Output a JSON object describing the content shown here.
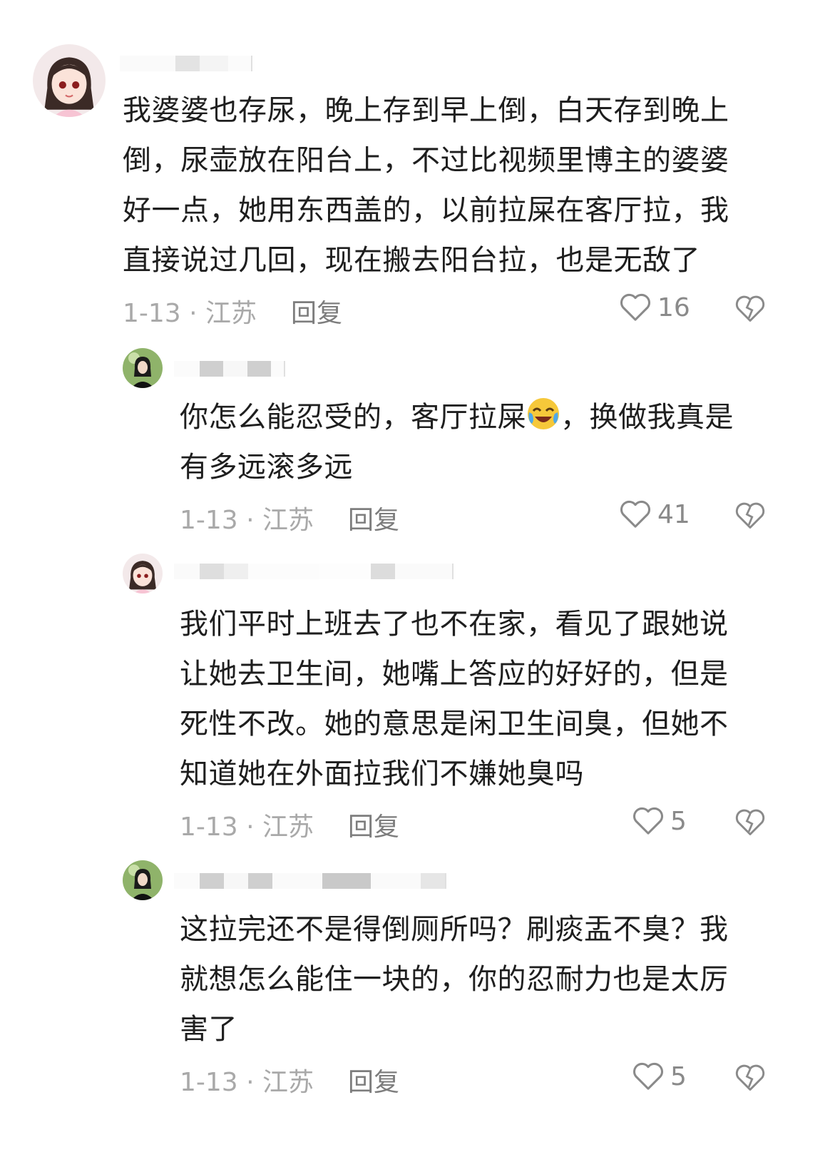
{
  "comments": [
    {
      "text": "我婆婆也存尿，晚上存到早上倒，白天存到晚上倒，尿壶放在阳台上，不过比视频里博主的婆婆好一点，她用东西盖的，以前拉屎在客厅拉，我直接说过几回，现在搬去阳台拉，也是无敌了",
      "lines": [
        "我婆婆也存尿，晚上存到早上倒，白天存到晚上",
        "倒，尿壶放在阳台上，不过比视频里博主的婆婆",
        "好一点，她用东西盖的，以前拉屎在客厅拉，我",
        "直接说过几回，现在搬去阳台拉，也是无敌了"
      ],
      "date_location": "1-13 · 江苏",
      "reply_label": "回复",
      "likes": "16"
    },
    {
      "lines_a": "你怎么能忍受的，客厅拉屎",
      "emoji": "crying-laughing-emoji",
      "lines_b": "，换做我真是",
      "line2": "有多远滚多远",
      "date_location": "1-13 · 江苏",
      "reply_label": "回复",
      "likes": "41"
    },
    {
      "lines": [
        "我们平时上班去了也不在家，看见了跟她说",
        "让她去卫生间，她嘴上答应的好好的，但是",
        "死性不改。她的意思是闲卫生间臭，但她不",
        "知道她在外面拉我们不嫌她臭吗"
      ],
      "date_location": "1-13 · 江苏",
      "reply_label": "回复",
      "likes": "5"
    },
    {
      "lines": [
        "这拉完还不是得倒厕所吗？刷痰盂不臭？我",
        "就想怎么能住一块的，你的忍耐力也是太厉",
        "害了"
      ],
      "date_location": "1-13 · 江苏",
      "reply_label": "回复",
      "likes": "5"
    }
  ],
  "colors": {
    "text": "#1e1e1e",
    "meta": "#a9a9a9",
    "reply": "#7d7d7d",
    "icon": "#8a8a8a"
  }
}
